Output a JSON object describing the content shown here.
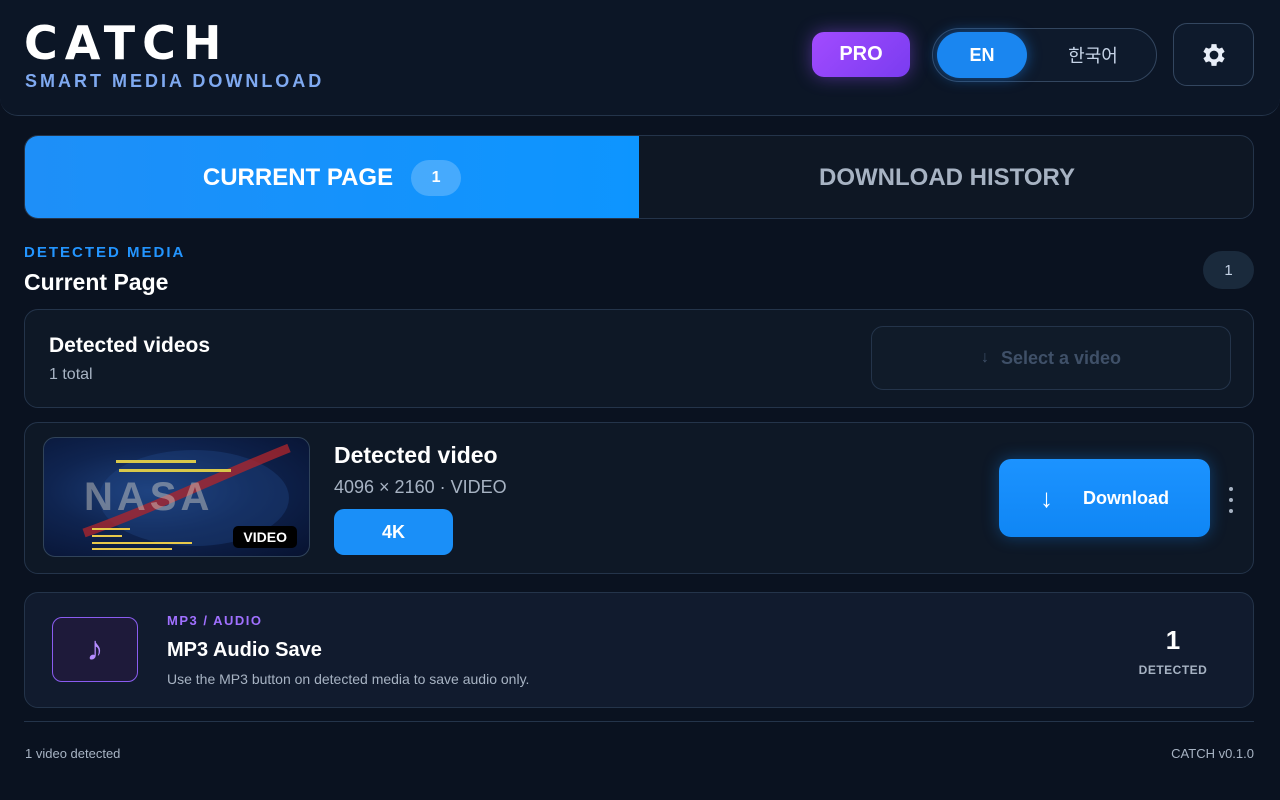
{
  "header": {
    "brand_title": "CATCH",
    "brand_subtitle": "SMART MEDIA DOWNLOAD",
    "pro_label": "PRO",
    "lang_en": "EN",
    "lang_ko": "한국어",
    "settings_icon": "gear-icon"
  },
  "tabs": {
    "current_label": "CURRENT PAGE",
    "current_count": "1",
    "history_label": "DOWNLOAD HISTORY"
  },
  "section": {
    "kicker": "DETECTED MEDIA",
    "title": "Current Page",
    "count": "1"
  },
  "summary": {
    "title": "Detected videos",
    "subtitle": "1 total",
    "select_label": "Select a video",
    "select_icon": "download-arrow-icon"
  },
  "video": {
    "badge": "VIDEO",
    "title": "Detected video",
    "meta": "4096 × 2160 · VIDEO",
    "quality": "4K",
    "download_label": "Download",
    "download_icon": "download-arrow-icon",
    "more_icon": "more-vertical-icon"
  },
  "audio": {
    "kicker": "MP3 / AUDIO",
    "title": "MP3 Audio Save",
    "description": "Use the MP3 button on detected media to save audio only.",
    "count": "1",
    "count_label": "DETECTED",
    "icon": "music-note-icon"
  },
  "footer": {
    "status": "1 video detected",
    "version": "CATCH v0.1.0"
  },
  "colors": {
    "accent": "#1a8ff8",
    "pro": "#9b47ff",
    "audio_accent": "#a070ff",
    "background": "#0a1220"
  }
}
